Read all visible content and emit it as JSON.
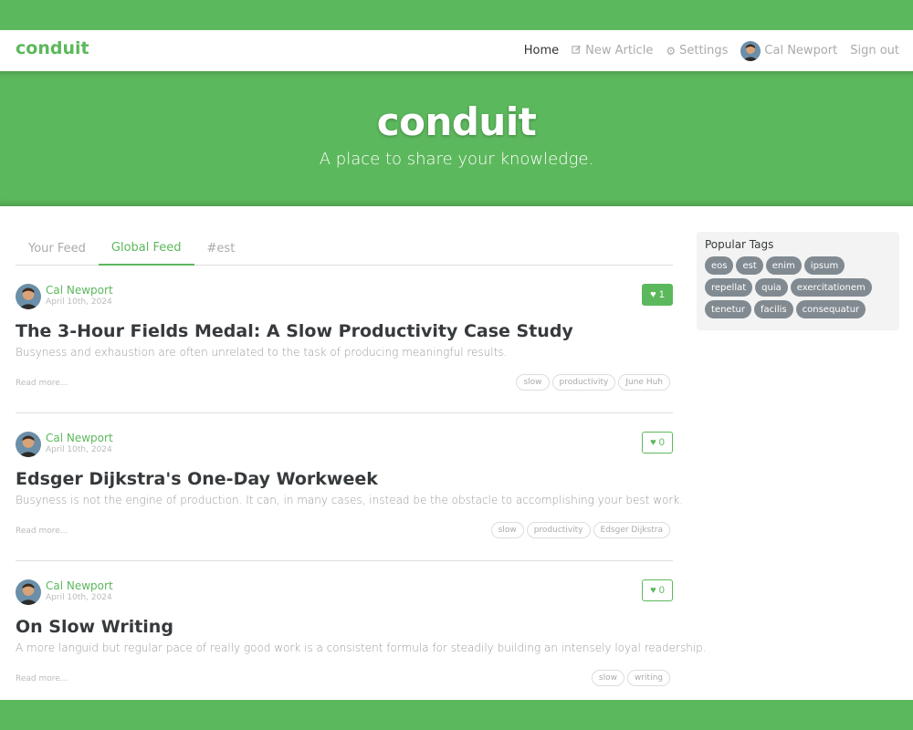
{
  "navbar": {
    "brand": "conduit",
    "links": [
      {
        "label": "Home"
      },
      {
        "label": "New Article",
        "icon": "edit-icon"
      },
      {
        "label": "Settings",
        "icon": "gear-icon"
      },
      {
        "label": "Cal Newport",
        "icon": "avatar"
      },
      {
        "label": "Sign out"
      }
    ]
  },
  "banner": {
    "title": "conduit",
    "subtitle": "A place to share your knowledge."
  },
  "tabs": [
    {
      "label": "Your Feed"
    },
    {
      "label": "Global Feed"
    },
    {
      "label": "#est"
    }
  ],
  "articles": [
    {
      "author": "Cal Newport",
      "date": "April 10th, 2024",
      "favorites": "1",
      "title": "The 3-Hour Fields Medal: A Slow Productivity Case Study",
      "description": "Busyness and exhaustion are often unrelated to the task of producing meaningful results.",
      "read_more": "Read more...",
      "tags": [
        "slow",
        "productivity",
        "June Huh"
      ]
    },
    {
      "author": "Cal Newport",
      "date": "April 10th, 2024",
      "favorites": "0",
      "title": "Edsger Dijkstra's One-Day Workweek",
      "description": "Busyness is not the engine of production. It can, in many cases, instead be the obstacle to accomplishing your best work.",
      "read_more": "Read more...",
      "tags": [
        "slow",
        "productivity",
        "Edsger Dijkstra"
      ]
    },
    {
      "author": "Cal Newport",
      "date": "April 10th, 2024",
      "favorites": "0",
      "title": "On Slow Writing",
      "description": "A more languid but regular pace of really good work is a consistent formula for steadily building an intensely loyal readership.",
      "read_more": "Read more...",
      "tags": [
        "slow",
        "writing"
      ]
    }
  ],
  "sidebar": {
    "title": "Popular Tags",
    "tags": [
      "eos",
      "est",
      "enim",
      "ipsum",
      "repellat",
      "quia",
      "exercitationem",
      "tenetur",
      "facilis",
      "consequatur"
    ]
  },
  "colors": {
    "brand": "#5cb85c",
    "tag_pill": "#818a91"
  }
}
